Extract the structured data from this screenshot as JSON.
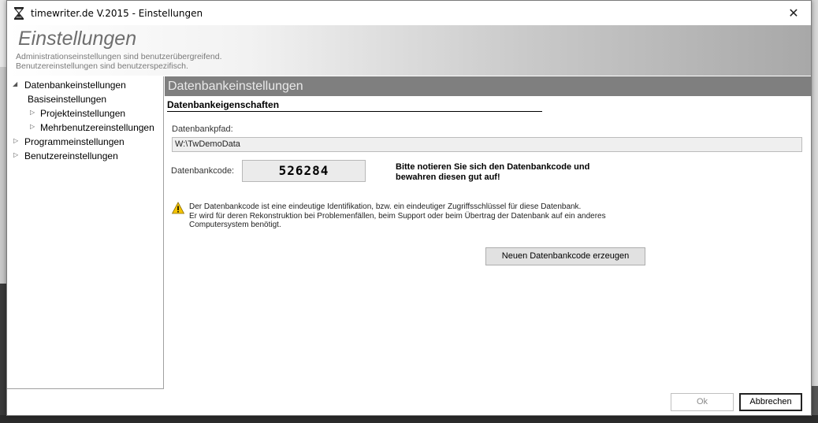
{
  "window": {
    "title": "timewriter.de V.2015 - Einstellungen",
    "close_glyph": "✕"
  },
  "header": {
    "title": "Einstellungen",
    "subtitle_line1": "Administrationseinstellungen sind benutzerübergreifend.",
    "subtitle_line2": "Benutzereinstellungen sind benutzerspezifisch."
  },
  "tree": {
    "expanded_glyph": "◢",
    "collapsed_glyph": "▷",
    "items": [
      {
        "label": "Datenbankeinstellungen",
        "state": "expanded"
      },
      {
        "label": "Basiseinstellungen",
        "state": "leaf"
      },
      {
        "label": "Projekteinstellungen",
        "state": "collapsed"
      },
      {
        "label": "Mehrbenutzereinstellungen",
        "state": "collapsed"
      },
      {
        "label": "Programmeinstellungen",
        "state": "collapsed"
      },
      {
        "label": "Benutzereinstellungen",
        "state": "collapsed"
      }
    ]
  },
  "panel": {
    "header": "Datenbankeinstellungen",
    "section_title": "Datenbankeigenschaften",
    "db_path_label": "Datenbankpfad:",
    "db_path_value": "W:\\TwDemoData",
    "db_code_label": "Datenbankcode:",
    "db_code_value": "526284",
    "db_code_note": "Bitte notieren Sie sich den Datenbankcode und bewahren diesen gut auf!",
    "info_line1": "Der Datenbankcode ist eine eindeutige Identifikation, bzw. ein eindeutiger Zugriffsschlüssel für diese Datenbank.",
    "info_line2": "Er wird für deren Rekonstruktion bei Problemenfällen, beim Support oder beim Übertrag der Datenbank auf ein anderes",
    "info_line3": "Computersystem benötigt.",
    "generate_button": "Neuen Datenbankcode erzeugen"
  },
  "footer": {
    "ok_button": "Ok",
    "cancel_button": "Abbrechen"
  },
  "colors": {
    "panel_header_bg": "#7f7f7f",
    "warning_yellow": "#f5c400"
  }
}
